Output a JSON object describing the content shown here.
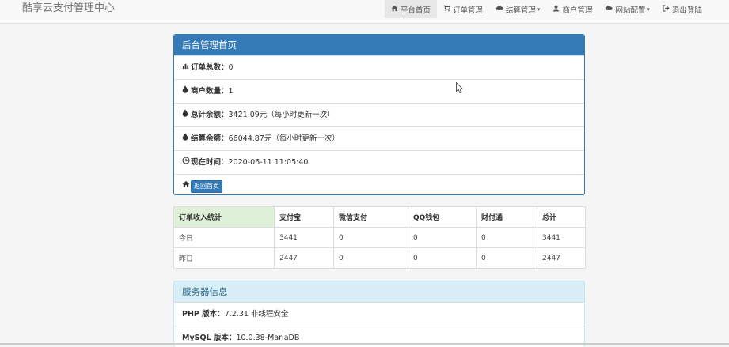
{
  "navbar": {
    "brand": "酷享云支付管理中心",
    "items": [
      {
        "icon": "home-icon",
        "glyph": "⌂",
        "label": "平台首页",
        "active": true,
        "dropdown": false
      },
      {
        "icon": "cart-icon",
        "glyph": "🛒",
        "label": "订单管理",
        "active": false,
        "dropdown": false
      },
      {
        "icon": "cloud-icon",
        "glyph": "☁",
        "label": "结算管理",
        "active": false,
        "dropdown": true
      },
      {
        "icon": "user-icon",
        "glyph": "👤",
        "label": "商户管理",
        "active": false,
        "dropdown": false
      },
      {
        "icon": "cloud-icon",
        "glyph": "☁",
        "label": "网站配置",
        "active": false,
        "dropdown": true
      },
      {
        "icon": "logout-icon",
        "glyph": "⇥",
        "label": "退出登陆",
        "active": false,
        "dropdown": false
      }
    ]
  },
  "overview": {
    "title": "后台管理首页",
    "order_total_label": "订单总数：",
    "order_total_value": "0",
    "merchant_count_label": "商户数量：",
    "merchant_count_value": "1",
    "total_balance_label": "总计余额：",
    "total_balance_value": "3421.09元（每小时更新一次）",
    "settle_balance_label": "结算余额：",
    "settle_balance_value": "66044.87元（每小时更新一次）",
    "current_time_label": "现在时间：",
    "current_time_value": "2020-06-11 11:05:40",
    "back_home_button": "返回首页"
  },
  "income_table": {
    "headers": [
      "订单收入统计",
      "支付宝",
      "微信支付",
      "QQ钱包",
      "财付通",
      "总计"
    ],
    "rows": [
      [
        "今日",
        "3441",
        "0",
        "0",
        "0",
        "3441"
      ],
      [
        "昨日",
        "2447",
        "0",
        "0",
        "0",
        "2447"
      ]
    ]
  },
  "server_info": {
    "title": "服务器信息",
    "php_label": "PHP 版本：",
    "php_value": "7.2.31 非线程安全",
    "mysql_label": "MySQL 版本：",
    "mysql_value": "10.0.38-MariaDB"
  }
}
